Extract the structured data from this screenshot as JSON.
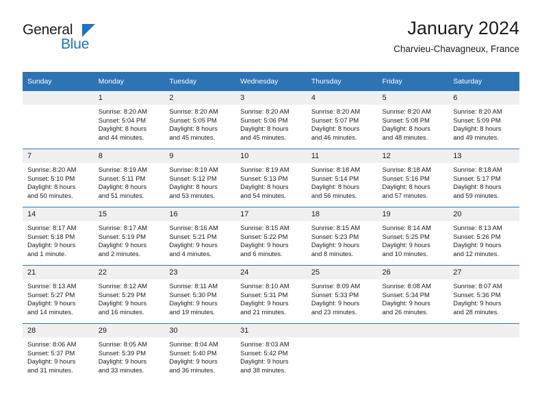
{
  "logo": {
    "word_one": "General",
    "word_two": "Blue",
    "triangle_color": "#1b76bc"
  },
  "header": {
    "title": "January 2024",
    "subtitle": "Charvieu-Chavagneux, France"
  },
  "theme": {
    "header_blue": "#2e74b5",
    "daynum_gray": "#f0f0f0",
    "text": "#1a1a1a"
  },
  "weekday_headers": [
    "Sunday",
    "Monday",
    "Tuesday",
    "Wednesday",
    "Thursday",
    "Friday",
    "Saturday"
  ],
  "weeks": [
    [
      {
        "day": "",
        "sunrise": "",
        "sunset": "",
        "daylight_1": "",
        "daylight_2": ""
      },
      {
        "day": "1",
        "sunrise": "Sunrise: 8:20 AM",
        "sunset": "Sunset: 5:04 PM",
        "daylight_1": "Daylight: 8 hours",
        "daylight_2": "and 44 minutes."
      },
      {
        "day": "2",
        "sunrise": "Sunrise: 8:20 AM",
        "sunset": "Sunset: 5:05 PM",
        "daylight_1": "Daylight: 8 hours",
        "daylight_2": "and 45 minutes."
      },
      {
        "day": "3",
        "sunrise": "Sunrise: 8:20 AM",
        "sunset": "Sunset: 5:06 PM",
        "daylight_1": "Daylight: 8 hours",
        "daylight_2": "and 45 minutes."
      },
      {
        "day": "4",
        "sunrise": "Sunrise: 8:20 AM",
        "sunset": "Sunset: 5:07 PM",
        "daylight_1": "Daylight: 8 hours",
        "daylight_2": "and 46 minutes."
      },
      {
        "day": "5",
        "sunrise": "Sunrise: 8:20 AM",
        "sunset": "Sunset: 5:08 PM",
        "daylight_1": "Daylight: 8 hours",
        "daylight_2": "and 48 minutes."
      },
      {
        "day": "6",
        "sunrise": "Sunrise: 8:20 AM",
        "sunset": "Sunset: 5:09 PM",
        "daylight_1": "Daylight: 8 hours",
        "daylight_2": "and 49 minutes."
      }
    ],
    [
      {
        "day": "7",
        "sunrise": "Sunrise: 8:20 AM",
        "sunset": "Sunset: 5:10 PM",
        "daylight_1": "Daylight: 8 hours",
        "daylight_2": "and 50 minutes."
      },
      {
        "day": "8",
        "sunrise": "Sunrise: 8:19 AM",
        "sunset": "Sunset: 5:11 PM",
        "daylight_1": "Daylight: 8 hours",
        "daylight_2": "and 51 minutes."
      },
      {
        "day": "9",
        "sunrise": "Sunrise: 8:19 AM",
        "sunset": "Sunset: 5:12 PM",
        "daylight_1": "Daylight: 8 hours",
        "daylight_2": "and 53 minutes."
      },
      {
        "day": "10",
        "sunrise": "Sunrise: 8:19 AM",
        "sunset": "Sunset: 5:13 PM",
        "daylight_1": "Daylight: 8 hours",
        "daylight_2": "and 54 minutes."
      },
      {
        "day": "11",
        "sunrise": "Sunrise: 8:18 AM",
        "sunset": "Sunset: 5:14 PM",
        "daylight_1": "Daylight: 8 hours",
        "daylight_2": "and 56 minutes."
      },
      {
        "day": "12",
        "sunrise": "Sunrise: 8:18 AM",
        "sunset": "Sunset: 5:16 PM",
        "daylight_1": "Daylight: 8 hours",
        "daylight_2": "and 57 minutes."
      },
      {
        "day": "13",
        "sunrise": "Sunrise: 8:18 AM",
        "sunset": "Sunset: 5:17 PM",
        "daylight_1": "Daylight: 8 hours",
        "daylight_2": "and 59 minutes."
      }
    ],
    [
      {
        "day": "14",
        "sunrise": "Sunrise: 8:17 AM",
        "sunset": "Sunset: 5:18 PM",
        "daylight_1": "Daylight: 9 hours",
        "daylight_2": "and 1 minute."
      },
      {
        "day": "15",
        "sunrise": "Sunrise: 8:17 AM",
        "sunset": "Sunset: 5:19 PM",
        "daylight_1": "Daylight: 9 hours",
        "daylight_2": "and 2 minutes."
      },
      {
        "day": "16",
        "sunrise": "Sunrise: 8:16 AM",
        "sunset": "Sunset: 5:21 PM",
        "daylight_1": "Daylight: 9 hours",
        "daylight_2": "and 4 minutes."
      },
      {
        "day": "17",
        "sunrise": "Sunrise: 8:15 AM",
        "sunset": "Sunset: 5:22 PM",
        "daylight_1": "Daylight: 9 hours",
        "daylight_2": "and 6 minutes."
      },
      {
        "day": "18",
        "sunrise": "Sunrise: 8:15 AM",
        "sunset": "Sunset: 5:23 PM",
        "daylight_1": "Daylight: 9 hours",
        "daylight_2": "and 8 minutes."
      },
      {
        "day": "19",
        "sunrise": "Sunrise: 8:14 AM",
        "sunset": "Sunset: 5:25 PM",
        "daylight_1": "Daylight: 9 hours",
        "daylight_2": "and 10 minutes."
      },
      {
        "day": "20",
        "sunrise": "Sunrise: 8:13 AM",
        "sunset": "Sunset: 5:26 PM",
        "daylight_1": "Daylight: 9 hours",
        "daylight_2": "and 12 minutes."
      }
    ],
    [
      {
        "day": "21",
        "sunrise": "Sunrise: 8:13 AM",
        "sunset": "Sunset: 5:27 PM",
        "daylight_1": "Daylight: 9 hours",
        "daylight_2": "and 14 minutes."
      },
      {
        "day": "22",
        "sunrise": "Sunrise: 8:12 AM",
        "sunset": "Sunset: 5:29 PM",
        "daylight_1": "Daylight: 9 hours",
        "daylight_2": "and 16 minutes."
      },
      {
        "day": "23",
        "sunrise": "Sunrise: 8:11 AM",
        "sunset": "Sunset: 5:30 PM",
        "daylight_1": "Daylight: 9 hours",
        "daylight_2": "and 19 minutes."
      },
      {
        "day": "24",
        "sunrise": "Sunrise: 8:10 AM",
        "sunset": "Sunset: 5:31 PM",
        "daylight_1": "Daylight: 9 hours",
        "daylight_2": "and 21 minutes."
      },
      {
        "day": "25",
        "sunrise": "Sunrise: 8:09 AM",
        "sunset": "Sunset: 5:33 PM",
        "daylight_1": "Daylight: 9 hours",
        "daylight_2": "and 23 minutes."
      },
      {
        "day": "26",
        "sunrise": "Sunrise: 8:08 AM",
        "sunset": "Sunset: 5:34 PM",
        "daylight_1": "Daylight: 9 hours",
        "daylight_2": "and 26 minutes."
      },
      {
        "day": "27",
        "sunrise": "Sunrise: 8:07 AM",
        "sunset": "Sunset: 5:36 PM",
        "daylight_1": "Daylight: 9 hours",
        "daylight_2": "and 28 minutes."
      }
    ],
    [
      {
        "day": "28",
        "sunrise": "Sunrise: 8:06 AM",
        "sunset": "Sunset: 5:37 PM",
        "daylight_1": "Daylight: 9 hours",
        "daylight_2": "and 31 minutes."
      },
      {
        "day": "29",
        "sunrise": "Sunrise: 8:05 AM",
        "sunset": "Sunset: 5:39 PM",
        "daylight_1": "Daylight: 9 hours",
        "daylight_2": "and 33 minutes."
      },
      {
        "day": "30",
        "sunrise": "Sunrise: 8:04 AM",
        "sunset": "Sunset: 5:40 PM",
        "daylight_1": "Daylight: 9 hours",
        "daylight_2": "and 36 minutes."
      },
      {
        "day": "31",
        "sunrise": "Sunrise: 8:03 AM",
        "sunset": "Sunset: 5:42 PM",
        "daylight_1": "Daylight: 9 hours",
        "daylight_2": "and 38 minutes."
      },
      {
        "day": "",
        "sunrise": "",
        "sunset": "",
        "daylight_1": "",
        "daylight_2": ""
      },
      {
        "day": "",
        "sunrise": "",
        "sunset": "",
        "daylight_1": "",
        "daylight_2": ""
      },
      {
        "day": "",
        "sunrise": "",
        "sunset": "",
        "daylight_1": "",
        "daylight_2": ""
      }
    ]
  ]
}
